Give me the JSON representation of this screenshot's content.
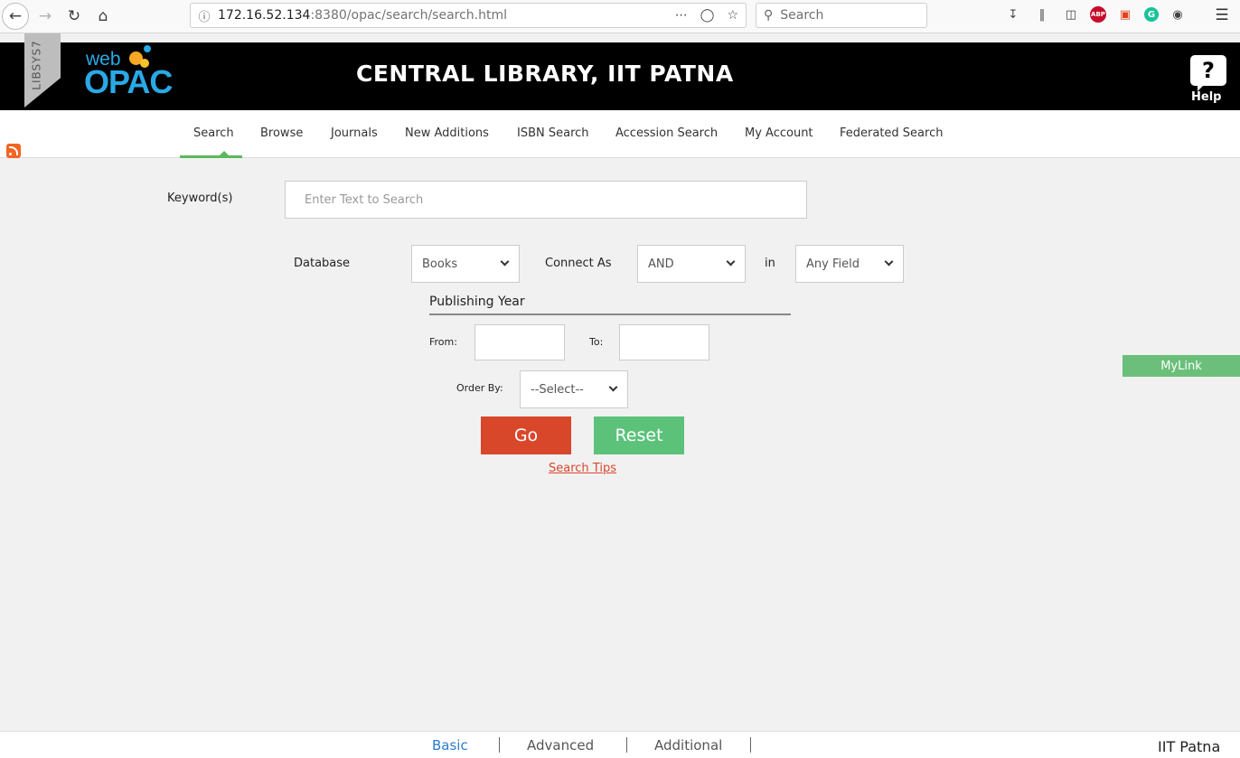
{
  "browser": {
    "url_host": "172.16.52.134",
    "url_path": ":8380/opac/search/search.html",
    "search_placeholder": "Search",
    "icons": [
      "back-icon",
      "forward-icon",
      "reload-icon",
      "home-icon",
      "info-icon",
      "more-icon",
      "pocket-icon",
      "bookmark-star-icon",
      "search-icon",
      "download-icon",
      "library-icon",
      "sidebar-icon",
      "adblock-icon",
      "screenshot-icon",
      "grammarly-icon",
      "account-icon",
      "menu-icon"
    ],
    "abp_text": "ABP",
    "grammarly_text": "G"
  },
  "header": {
    "ribbon_text": "LIBSYS7",
    "logo_web": "web",
    "logo_opac": "OPAC",
    "title": "CENTRAL LIBRARY, IIT PATNA",
    "help_icon": "?",
    "help_label": "Help",
    "colors": {
      "bg": "#000000",
      "logo": "#29a9e6"
    }
  },
  "nav": {
    "items": [
      "Search",
      "Browse",
      "Journals",
      "New Additions",
      "ISBN Search",
      "Accession Search",
      "My Account",
      "Federated Search"
    ],
    "active": "Search",
    "accent": "#5cb85c"
  },
  "form": {
    "keyword_label": "Keyword(s)",
    "keyword_placeholder": "Enter Text to Search",
    "database_label": "Database",
    "database_value": "Books",
    "connect_label": "Connect As",
    "connect_value": "AND",
    "in_label": "in",
    "field_value": "Any Field",
    "publishing_year_label": "Publishing Year",
    "from_label": "From:",
    "to_label": "To:",
    "order_label": "Order By:",
    "order_value": "--Select--",
    "go_label": "Go",
    "reset_label": "Reset",
    "tips_label": "Search Tips",
    "colors": {
      "go": "#d9472b",
      "reset": "#5cc27a"
    }
  },
  "mylink_label": "MyLink",
  "footer": {
    "tabs": [
      "Basic",
      "Advanced",
      "Additional"
    ],
    "active": "Basic",
    "org": "IIT Patna"
  }
}
